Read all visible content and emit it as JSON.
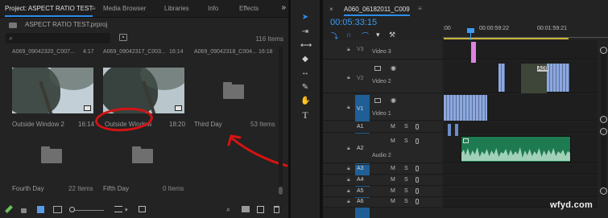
{
  "project_panel": {
    "tabs": [
      {
        "label": "Project: ASPECT RATIO TEST",
        "active": true
      },
      {
        "label": "Media Browser"
      },
      {
        "label": "Libraries"
      },
      {
        "label": "Info"
      },
      {
        "label": "Effects"
      }
    ],
    "tab_menu_glyph": "≡",
    "overflow_glyph": "»",
    "project_file": "ASPECT RATIO TEST.prproj",
    "search": {
      "value": "",
      "glyph": "⌕"
    },
    "item_count": "116 Items",
    "clips": [
      {
        "header": "A069_09042320_C007...",
        "header_duration": "4:17",
        "name": "Outside Window 2",
        "duration": "16:14"
      },
      {
        "header": "A069_09042317_C003...",
        "header_duration": "16:14",
        "name": "Outside Window",
        "duration": "18:20"
      },
      {
        "header": "A069_09042318_C004...",
        "header_duration": "16:18"
      }
    ],
    "bins": [
      {
        "name": "Third Day",
        "count": "53 Items"
      },
      {
        "name": "Fourth Day",
        "count": "22 Items"
      },
      {
        "name": "Fifth Day",
        "count": "0 Items"
      }
    ],
    "bottom_icons": [
      "pencil-icon",
      "lock-icon",
      "list-view-icon",
      "icon-view-icon",
      "zoom-slider",
      "sort-icon",
      "automate-icon",
      "find-icon",
      "new-bin-icon",
      "new-item-icon",
      "clear-icon"
    ],
    "colors": {
      "accent": "#2d8ceb",
      "annotation_red": "#d51313",
      "pencil_green": "#6dc05b"
    }
  },
  "tools": [
    {
      "name": "selection-tool",
      "glyph": "➤",
      "selected": true
    },
    {
      "name": "track-select-tool",
      "glyph": "⇥"
    },
    {
      "name": "ripple-edit-tool",
      "glyph": "⟷"
    },
    {
      "name": "razor-tool",
      "glyph": "◆"
    },
    {
      "name": "slip-tool",
      "glyph": "↔"
    },
    {
      "name": "pen-tool",
      "glyph": "✎"
    },
    {
      "name": "hand-tool",
      "glyph": "✋"
    },
    {
      "name": "type-tool",
      "glyph": "T"
    }
  ],
  "timeline": {
    "close_glyph": "×",
    "sequence_name": "A060_06182011_C009",
    "menu_glyph": "≡",
    "timecode": "00:05:33:15",
    "ruler_labels": [
      ":00",
      "00:00:59:22",
      "00:01:59:21"
    ],
    "tracks": {
      "video": [
        {
          "id": "V3",
          "name": "Video 3"
        },
        {
          "id": "V2",
          "name": "Video 2"
        },
        {
          "id": "V1",
          "name": "Video 1"
        }
      ],
      "audio": [
        {
          "id": "A1",
          "name": ""
        },
        {
          "id": "A2",
          "name": "Audio 2"
        },
        {
          "id": "A3",
          "name": ""
        },
        {
          "id": "A4",
          "name": ""
        },
        {
          "id": "A5",
          "name": ""
        },
        {
          "id": "A6",
          "name": ""
        }
      ]
    },
    "mute_label": "M",
    "solo_label": "S",
    "clip_label_v2": "A06",
    "colors": {
      "timecode_blue": "#3c9bf5",
      "track_target": "#1f5f96",
      "video_clip": "#8ca8de",
      "audio_clip": "#1e7a51",
      "adjustment_clip": "#dd83e0"
    }
  },
  "watermark": "wfyd.com"
}
